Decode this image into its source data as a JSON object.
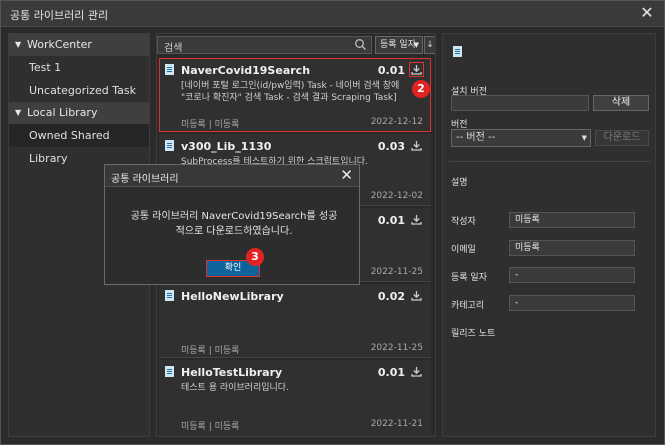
{
  "window": {
    "title": "공통 라이브러리 관리"
  },
  "left": {
    "groups": [
      {
        "label": "WorkCenter",
        "items": [
          "Test 1",
          "Uncategorized Task"
        ]
      },
      {
        "label": "Local Library",
        "items": [
          "Owned Shared Library"
        ]
      }
    ]
  },
  "search": {
    "label": "검색",
    "sort_label": "등록 일자",
    "sort_dir": "↓"
  },
  "list": [
    {
      "name": "NaverCovid19Search",
      "version": "0.01",
      "desc": "[네이버 포털 로그인(id/pw입력) Task - 네이버 검색 창에 \"코로나 확진자\" 검색 Task - 검색 결과 Scraping Task]",
      "meta": "미등록 | 미등록",
      "date": "2022-12-12"
    },
    {
      "name": "v300_Lib_1130",
      "version": "0.03",
      "desc": "SubProcess를 테스트하기 위한 스크립트입니다.",
      "meta": "",
      "date": "2022-12-02"
    },
    {
      "name": "",
      "version": "0.01",
      "desc": "",
      "meta": "",
      "date": "2022-11-25"
    },
    {
      "name": "HelloNewLibrary",
      "version": "0.02",
      "desc": "",
      "meta": "미등록 | 미등록",
      "date": "2022-11-25"
    },
    {
      "name": "HelloTestLibrary",
      "version": "0.01",
      "desc": "테스트 용 라이브러리입니다.",
      "meta": "미등록 | 미등록",
      "date": "2022-11-21"
    }
  ],
  "right": {
    "installed_version_label": "설치 버전",
    "delete_button": "삭제",
    "version_label": "버전",
    "version_select": "-- 버전 --",
    "download_button": "다운로드",
    "description_label": "설명",
    "author_label": "작성자",
    "author_value": "미등록",
    "email_label": "이메일",
    "email_value": "미등록",
    "registered_label": "등록 일자",
    "registered_value": "-",
    "category_label": "카테고리",
    "category_value": "-",
    "release_notes_label": "릴리즈 노트"
  },
  "dialog": {
    "title": "공통 라이브러리",
    "message": "공통 라이브러리 NaverCovid19Search를 성공적으로 다운로드하였습니다.",
    "ok_button": "확인"
  },
  "badges": {
    "b2": "2",
    "b3": "3"
  },
  "colors": {
    "accent": "#0e639c",
    "highlight": "#e03030",
    "badge": "#e02424"
  }
}
